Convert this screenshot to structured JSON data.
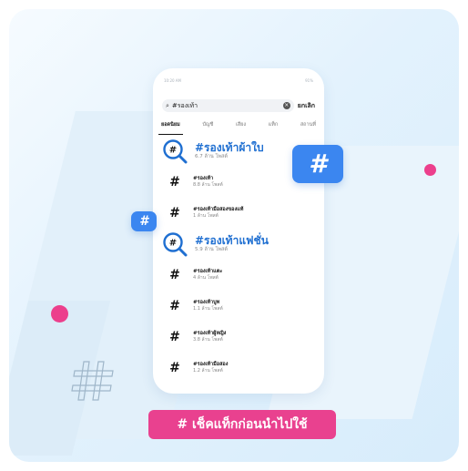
{
  "status_bar": {
    "time": "10:20 AM",
    "battery": "91%"
  },
  "search": {
    "query": "#รองเท้า",
    "cancel_label": "ยกเลิก"
  },
  "tabs": [
    {
      "label": "ยอดนิยม",
      "active": true
    },
    {
      "label": "บัญชี",
      "active": false
    },
    {
      "label": "เสียง",
      "active": false
    },
    {
      "label": "แท็ก",
      "active": false
    },
    {
      "label": "สถานที่",
      "active": false
    }
  ],
  "results": [
    {
      "tag": "#รองเท้าผ้าใบ",
      "count": "6.7 ล้าน โพสต์",
      "highlight": true
    },
    {
      "tag": "#รองเท้า",
      "count": "8.8 ล้าน โพสต์",
      "highlight": false
    },
    {
      "tag": "#รองเท้ามือสองของแท้",
      "count": "1 ล้าน โพสต์",
      "highlight": false
    },
    {
      "tag": "#รองเท้าแฟชั่น",
      "count": "5.9 ล้าน โพสต์",
      "highlight": true
    },
    {
      "tag": "#รองเท้าแตะ",
      "count": "4 ล้าน โพสต์",
      "highlight": false
    },
    {
      "tag": "#รองเท้าบูท",
      "count": "1.1 ล้าน โพสต์",
      "highlight": false
    },
    {
      "tag": "#รองเท้าผู้หญิง",
      "count": "3.8 ล้าน โพสต์",
      "highlight": false
    },
    {
      "tag": "#รองเท้ามือสอง",
      "count": "1.2 ล้าน โพสต์",
      "highlight": false
    }
  ],
  "hash_symbol": "#",
  "banner": {
    "text": "# เช็คแท็กก่อนนำไปใช้"
  },
  "colors": {
    "accent_blue": "#3b86f0",
    "accent_pink": "#e9418f",
    "tag_blue": "#1f6fd1"
  },
  "icons": [
    "search-icon",
    "clear-icon",
    "magnifier-hash-icon",
    "hash-icon"
  ]
}
